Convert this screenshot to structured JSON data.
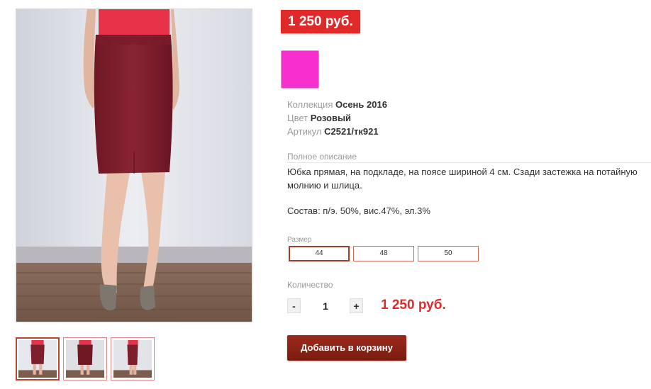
{
  "product": {
    "price_badge": "1 250 руб.",
    "color_swatch": "#f72fcf",
    "collection_label": "Коллекция",
    "collection_value": "Осень 2016",
    "color_label": "Цвет",
    "color_value": "Розовый",
    "sku_label": "Артикул",
    "sku_value": "С2521/тк921",
    "description_label": "Полное описание",
    "description": "Юбка прямая, на подкладе, на поясе шириной 4 см. Сзади застежка на потайную молнию и шлица.",
    "composition": "Состав: п/э. 50%, вис.47%, эл.3%"
  },
  "size": {
    "label": "Размер",
    "options": [
      "44",
      "48",
      "50"
    ],
    "selected": "44"
  },
  "quantity": {
    "label": "Количество",
    "minus": "-",
    "value": "1",
    "plus": "+",
    "total": "1 250 руб."
  },
  "cart": {
    "button_label": "Добавить в корзину"
  },
  "colors": {
    "accent_red": "#e02a2a",
    "cart_button": "#8b2315",
    "skirt": "#7d1e2c",
    "top": "#e8324a"
  }
}
